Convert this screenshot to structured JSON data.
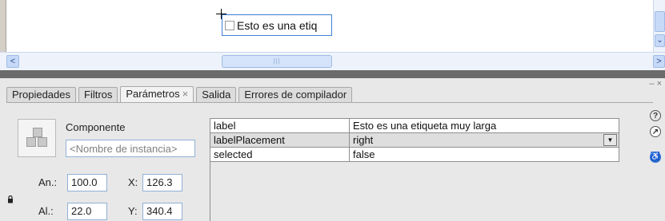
{
  "stage": {
    "component_label": "Esto es una etiq"
  },
  "scroll": {
    "left_arrow": "<",
    "right_arrow": ">",
    "down_arrow": "⌄",
    "thumb_grip": "|||"
  },
  "panel": {
    "tabs": [
      {
        "label": "Propiedades"
      },
      {
        "label": "Filtros"
      },
      {
        "label": "Parámetros",
        "close": "×"
      },
      {
        "label": "Salida"
      },
      {
        "label": "Errores de compilador"
      }
    ],
    "controls": "– ×",
    "component": {
      "title": "Componente",
      "instance_placeholder": "<Nombre de instancia>"
    },
    "dimensions": {
      "width_label": "An.:",
      "width_value": "100.0",
      "height_label": "Al.:",
      "height_value": "22.0",
      "x_label": "X:",
      "x_value": "126.3",
      "y_label": "Y:",
      "y_value": "340.4"
    },
    "parameters": [
      {
        "name": "label",
        "value": "Esto es una etiqueta muy larga"
      },
      {
        "name": "labelPlacement",
        "value": "right"
      },
      {
        "name": "selected",
        "value": "false"
      }
    ],
    "icons": {
      "help": "?",
      "link": "↗",
      "accessibility": "♿"
    }
  },
  "colors": {
    "accent": "#3c7fd6",
    "divider": "#6b6b6b",
    "accessibility": "#2a6ed3"
  }
}
